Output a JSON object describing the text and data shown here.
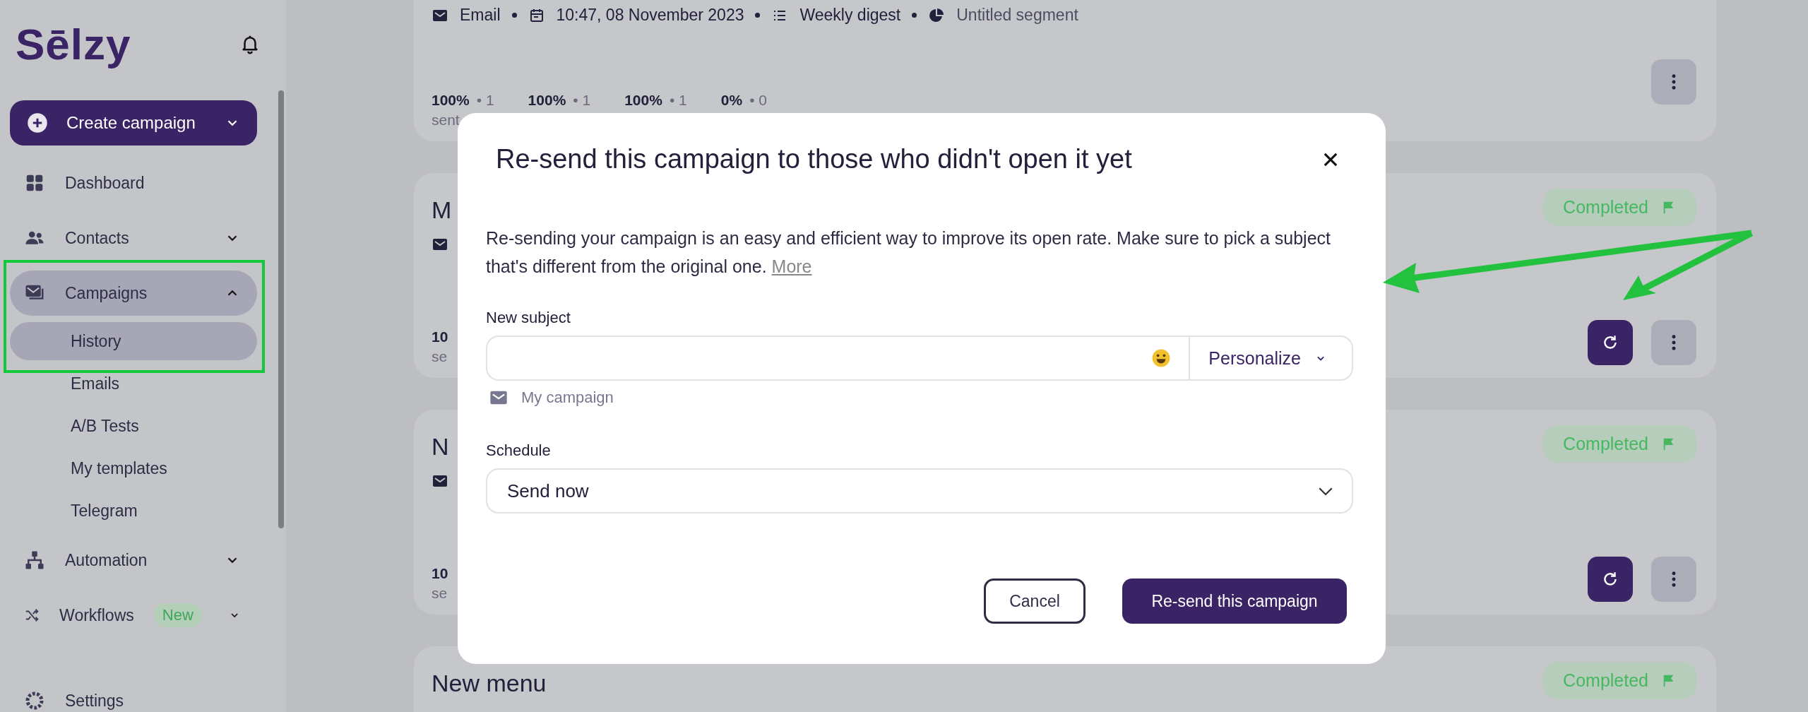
{
  "sidebar": {
    "logo": "Sēlzy",
    "create": {
      "label": "Create campaign",
      "expanded": false
    },
    "nav": [
      {
        "label": "Dashboard",
        "selected": false
      },
      {
        "label": "Contacts",
        "selected": false,
        "expanded": false
      },
      {
        "label": "Campaigns",
        "selected": true,
        "expanded": true,
        "children": [
          {
            "label": "History",
            "selected": true
          },
          {
            "label": "Emails",
            "selected": false
          },
          {
            "label": "A/B Tests",
            "selected": false
          },
          {
            "label": "My templates",
            "selected": false
          },
          {
            "label": "Telegram",
            "selected": false
          }
        ]
      },
      {
        "label": "Automation",
        "selected": false,
        "expanded": false
      },
      {
        "label": "Workflows",
        "selected": false,
        "expanded": false,
        "badge": "New"
      },
      {
        "label": "Settings",
        "selected": false
      }
    ]
  },
  "campaigns": [
    {
      "meta": [
        "Email",
        "10:47, 08 November 2023",
        "Weekly digest",
        "Untitled segment"
      ],
      "stats": [
        {
          "value": "100%",
          "count": "• 1",
          "label": "sent"
        },
        {
          "value": "100%",
          "count": "• 1"
        },
        {
          "value": "100%",
          "count": "• 1"
        },
        {
          "value": "0%",
          "count": "• 0"
        }
      ],
      "buttons": [
        {
          "kind": "more"
        }
      ]
    },
    {
      "title": "M",
      "status": "Completed",
      "stats": [
        {
          "value": "10",
          "label": "se"
        }
      ],
      "buttons": [
        {
          "kind": "resend"
        },
        {
          "kind": "more"
        }
      ]
    },
    {
      "title": "N",
      "status": "Completed",
      "stats": [
        {
          "value": "10",
          "label": "se"
        }
      ],
      "buttons": [
        {
          "kind": "resend"
        },
        {
          "kind": "more"
        }
      ]
    },
    {
      "title": "New menu",
      "status": "Completed"
    }
  ],
  "dialog": {
    "title": "Re-send this campaign to those who didn't open it yet",
    "description": "Re-sending your campaign is an easy and efficient way to improve its open rate. Make sure to pick a subject that's different from the original one.",
    "link": "More",
    "subject": {
      "label": "New subject",
      "personalize": "Personalize",
      "hint": "My campaign"
    },
    "schedule": {
      "label": "Schedule",
      "value": "Send now"
    },
    "buttons": [
      {
        "label": "Cancel",
        "kind": "secondary"
      },
      {
        "label": "Re-send this campaign",
        "kind": "primary"
      }
    ]
  }
}
